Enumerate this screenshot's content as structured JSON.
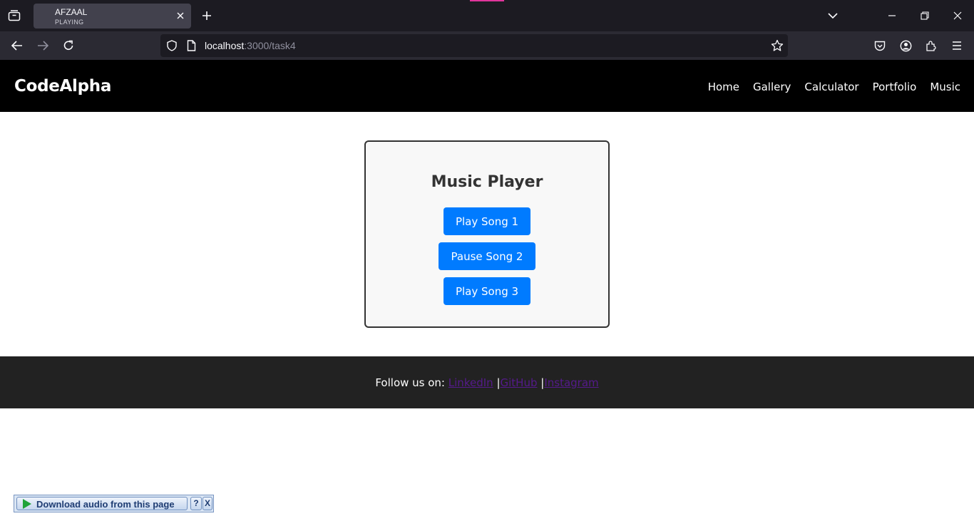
{
  "browser": {
    "tab": {
      "title": "AFZAAL",
      "status": "PLAYING"
    },
    "url": {
      "host": "localhost",
      "rest": ":3000/task4"
    }
  },
  "site": {
    "logo": "CodeAlpha",
    "nav": [
      "Home",
      "Gallery",
      "Calculator",
      "Portfolio",
      "Music"
    ]
  },
  "player": {
    "title": "Music Player",
    "buttons": [
      "Play Song 1",
      "Pause Song 2",
      "Play Song 3"
    ]
  },
  "footer": {
    "prefix": "Follow us on:",
    "links": [
      "LinkedIn",
      "GitHub",
      "Instagram"
    ],
    "separator": "|"
  },
  "download_widget": {
    "label": "Download audio from this page",
    "help": "?",
    "close": "X"
  },
  "colors": {
    "button": "#007bff",
    "header_bg": "#000000",
    "footer_bg": "#222222",
    "link_visited": "#551a8b"
  }
}
